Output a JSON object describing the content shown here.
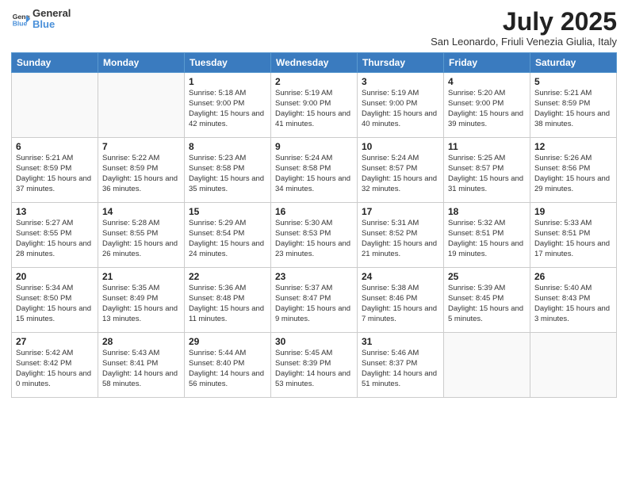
{
  "logo": {
    "line1": "General",
    "line2": "Blue"
  },
  "title": "July 2025",
  "subtitle": "San Leonardo, Friuli Venezia Giulia, Italy",
  "weekdays": [
    "Sunday",
    "Monday",
    "Tuesday",
    "Wednesday",
    "Thursday",
    "Friday",
    "Saturday"
  ],
  "weeks": [
    [
      {
        "day": "",
        "sunrise": "",
        "sunset": "",
        "daylight": ""
      },
      {
        "day": "",
        "sunrise": "",
        "sunset": "",
        "daylight": ""
      },
      {
        "day": "1",
        "sunrise": "Sunrise: 5:18 AM",
        "sunset": "Sunset: 9:00 PM",
        "daylight": "Daylight: 15 hours and 42 minutes."
      },
      {
        "day": "2",
        "sunrise": "Sunrise: 5:19 AM",
        "sunset": "Sunset: 9:00 PM",
        "daylight": "Daylight: 15 hours and 41 minutes."
      },
      {
        "day": "3",
        "sunrise": "Sunrise: 5:19 AM",
        "sunset": "Sunset: 9:00 PM",
        "daylight": "Daylight: 15 hours and 40 minutes."
      },
      {
        "day": "4",
        "sunrise": "Sunrise: 5:20 AM",
        "sunset": "Sunset: 9:00 PM",
        "daylight": "Daylight: 15 hours and 39 minutes."
      },
      {
        "day": "5",
        "sunrise": "Sunrise: 5:21 AM",
        "sunset": "Sunset: 8:59 PM",
        "daylight": "Daylight: 15 hours and 38 minutes."
      }
    ],
    [
      {
        "day": "6",
        "sunrise": "Sunrise: 5:21 AM",
        "sunset": "Sunset: 8:59 PM",
        "daylight": "Daylight: 15 hours and 37 minutes."
      },
      {
        "day": "7",
        "sunrise": "Sunrise: 5:22 AM",
        "sunset": "Sunset: 8:59 PM",
        "daylight": "Daylight: 15 hours and 36 minutes."
      },
      {
        "day": "8",
        "sunrise": "Sunrise: 5:23 AM",
        "sunset": "Sunset: 8:58 PM",
        "daylight": "Daylight: 15 hours and 35 minutes."
      },
      {
        "day": "9",
        "sunrise": "Sunrise: 5:24 AM",
        "sunset": "Sunset: 8:58 PM",
        "daylight": "Daylight: 15 hours and 34 minutes."
      },
      {
        "day": "10",
        "sunrise": "Sunrise: 5:24 AM",
        "sunset": "Sunset: 8:57 PM",
        "daylight": "Daylight: 15 hours and 32 minutes."
      },
      {
        "day": "11",
        "sunrise": "Sunrise: 5:25 AM",
        "sunset": "Sunset: 8:57 PM",
        "daylight": "Daylight: 15 hours and 31 minutes."
      },
      {
        "day": "12",
        "sunrise": "Sunrise: 5:26 AM",
        "sunset": "Sunset: 8:56 PM",
        "daylight": "Daylight: 15 hours and 29 minutes."
      }
    ],
    [
      {
        "day": "13",
        "sunrise": "Sunrise: 5:27 AM",
        "sunset": "Sunset: 8:55 PM",
        "daylight": "Daylight: 15 hours and 28 minutes."
      },
      {
        "day": "14",
        "sunrise": "Sunrise: 5:28 AM",
        "sunset": "Sunset: 8:55 PM",
        "daylight": "Daylight: 15 hours and 26 minutes."
      },
      {
        "day": "15",
        "sunrise": "Sunrise: 5:29 AM",
        "sunset": "Sunset: 8:54 PM",
        "daylight": "Daylight: 15 hours and 24 minutes."
      },
      {
        "day": "16",
        "sunrise": "Sunrise: 5:30 AM",
        "sunset": "Sunset: 8:53 PM",
        "daylight": "Daylight: 15 hours and 23 minutes."
      },
      {
        "day": "17",
        "sunrise": "Sunrise: 5:31 AM",
        "sunset": "Sunset: 8:52 PM",
        "daylight": "Daylight: 15 hours and 21 minutes."
      },
      {
        "day": "18",
        "sunrise": "Sunrise: 5:32 AM",
        "sunset": "Sunset: 8:51 PM",
        "daylight": "Daylight: 15 hours and 19 minutes."
      },
      {
        "day": "19",
        "sunrise": "Sunrise: 5:33 AM",
        "sunset": "Sunset: 8:51 PM",
        "daylight": "Daylight: 15 hours and 17 minutes."
      }
    ],
    [
      {
        "day": "20",
        "sunrise": "Sunrise: 5:34 AM",
        "sunset": "Sunset: 8:50 PM",
        "daylight": "Daylight: 15 hours and 15 minutes."
      },
      {
        "day": "21",
        "sunrise": "Sunrise: 5:35 AM",
        "sunset": "Sunset: 8:49 PM",
        "daylight": "Daylight: 15 hours and 13 minutes."
      },
      {
        "day": "22",
        "sunrise": "Sunrise: 5:36 AM",
        "sunset": "Sunset: 8:48 PM",
        "daylight": "Daylight: 15 hours and 11 minutes."
      },
      {
        "day": "23",
        "sunrise": "Sunrise: 5:37 AM",
        "sunset": "Sunset: 8:47 PM",
        "daylight": "Daylight: 15 hours and 9 minutes."
      },
      {
        "day": "24",
        "sunrise": "Sunrise: 5:38 AM",
        "sunset": "Sunset: 8:46 PM",
        "daylight": "Daylight: 15 hours and 7 minutes."
      },
      {
        "day": "25",
        "sunrise": "Sunrise: 5:39 AM",
        "sunset": "Sunset: 8:45 PM",
        "daylight": "Daylight: 15 hours and 5 minutes."
      },
      {
        "day": "26",
        "sunrise": "Sunrise: 5:40 AM",
        "sunset": "Sunset: 8:43 PM",
        "daylight": "Daylight: 15 hours and 3 minutes."
      }
    ],
    [
      {
        "day": "27",
        "sunrise": "Sunrise: 5:42 AM",
        "sunset": "Sunset: 8:42 PM",
        "daylight": "Daylight: 15 hours and 0 minutes."
      },
      {
        "day": "28",
        "sunrise": "Sunrise: 5:43 AM",
        "sunset": "Sunset: 8:41 PM",
        "daylight": "Daylight: 14 hours and 58 minutes."
      },
      {
        "day": "29",
        "sunrise": "Sunrise: 5:44 AM",
        "sunset": "Sunset: 8:40 PM",
        "daylight": "Daylight: 14 hours and 56 minutes."
      },
      {
        "day": "30",
        "sunrise": "Sunrise: 5:45 AM",
        "sunset": "Sunset: 8:39 PM",
        "daylight": "Daylight: 14 hours and 53 minutes."
      },
      {
        "day": "31",
        "sunrise": "Sunrise: 5:46 AM",
        "sunset": "Sunset: 8:37 PM",
        "daylight": "Daylight: 14 hours and 51 minutes."
      },
      {
        "day": "",
        "sunrise": "",
        "sunset": "",
        "daylight": ""
      },
      {
        "day": "",
        "sunrise": "",
        "sunset": "",
        "daylight": ""
      }
    ]
  ]
}
